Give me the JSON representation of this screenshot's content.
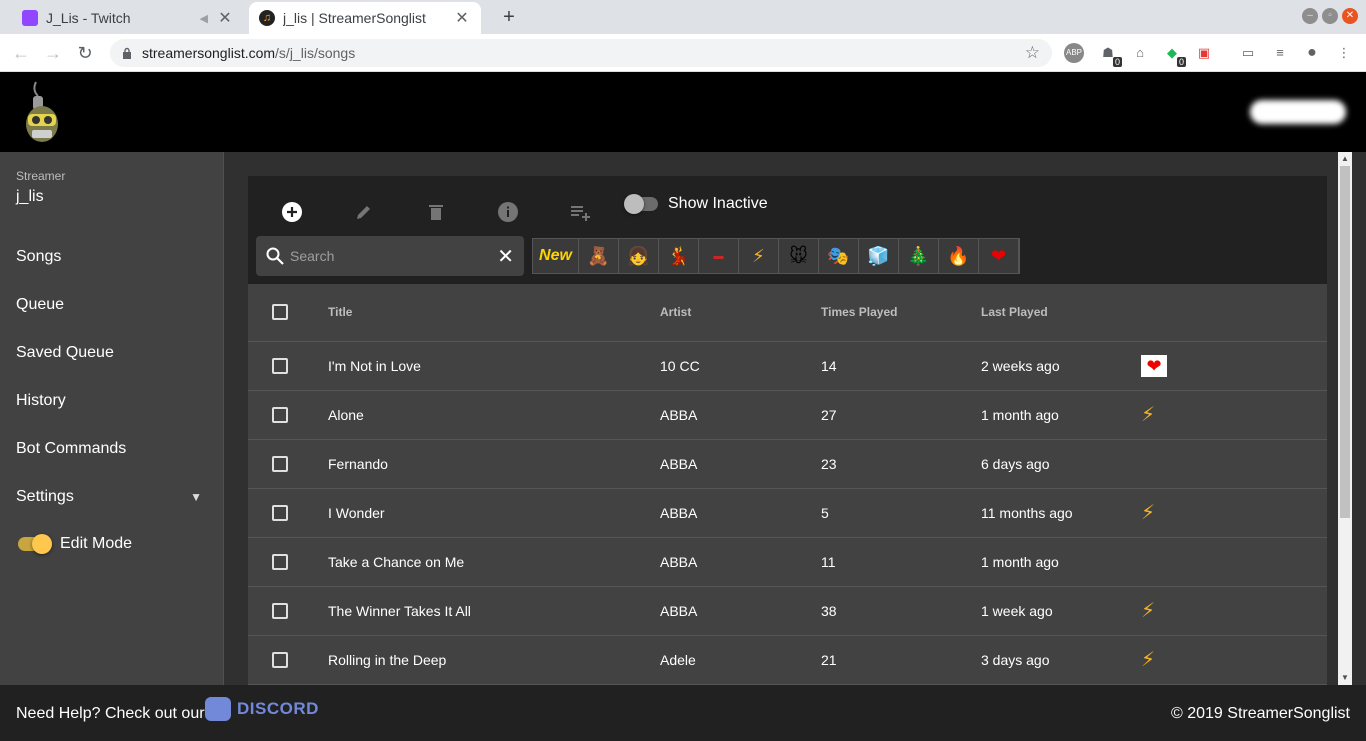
{
  "browser": {
    "tabs": [
      {
        "title": "J_Lis - Twitch",
        "favicon": "twitch-icon",
        "color": "#9146ff"
      },
      {
        "title": "j_lis | StreamerSonglist",
        "favicon": "music-note-icon",
        "color": "#f5a623"
      }
    ],
    "url_host": "streamersonglist.com",
    "url_path": "/s/j_lis/songs",
    "ext_badges": [
      "0",
      "0"
    ]
  },
  "sidebar": {
    "streamer_label": "Streamer",
    "streamer_name": "j_lis",
    "items": [
      "Songs",
      "Queue",
      "Saved Queue",
      "History",
      "Bot Commands",
      "Settings"
    ],
    "edit_mode_label": "Edit Mode",
    "edit_mode_on": true
  },
  "toolbar": {
    "show_inactive_label": "Show Inactive",
    "show_inactive_on": false,
    "search_placeholder": "Search",
    "new_tag": "New",
    "tag_icons": [
      "bear-emote-icon",
      "girl-emote-icon",
      "red-dress-emote-icon",
      "red-tag-emote-icon",
      "lightning-icon",
      "mickey-icon",
      "vibe-emote-icon",
      "ice-cube-icon",
      "tree-icon",
      "fire-globe-icon",
      "pixel-heart-icon"
    ]
  },
  "table": {
    "columns": [
      "Title",
      "Artist",
      "Times Played",
      "Last Played"
    ],
    "rows": [
      {
        "title": "I'm Not in Love",
        "artist": "10 CC",
        "times": "14",
        "last": "2 weeks ago",
        "tag": "heart"
      },
      {
        "title": "Alone",
        "artist": "ABBA",
        "times": "27",
        "last": "1 month ago",
        "tag": "bolt"
      },
      {
        "title": "Fernando",
        "artist": "ABBA",
        "times": "23",
        "last": "6 days ago",
        "tag": ""
      },
      {
        "title": "I Wonder",
        "artist": "ABBA",
        "times": "5",
        "last": "11 months ago",
        "tag": "bolt"
      },
      {
        "title": "Take a Chance on Me",
        "artist": "ABBA",
        "times": "11",
        "last": "1 month ago",
        "tag": ""
      },
      {
        "title": "The Winner Takes It All",
        "artist": "ABBA",
        "times": "38",
        "last": "1 week ago",
        "tag": "bolt"
      },
      {
        "title": "Rolling in the Deep",
        "artist": "Adele",
        "times": "21",
        "last": "3 days ago",
        "tag": "bolt"
      }
    ]
  },
  "footer": {
    "help_text": "Need Help? Check out our",
    "discord_label": "DISCORD",
    "copyright": "© 2019 StreamerSonglist"
  },
  "colors": {
    "accent_yellow": "#ffc74d",
    "bolt": "#f5b324",
    "discord": "#7289da"
  }
}
